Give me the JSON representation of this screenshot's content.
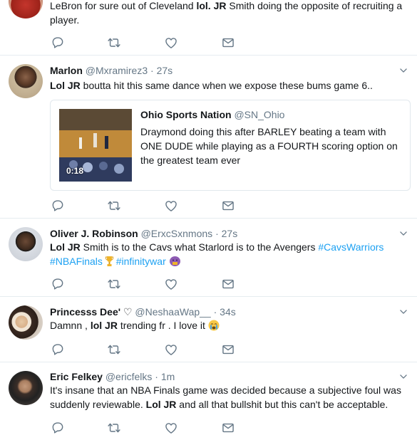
{
  "tweets": [
    {
      "text_parts": [
        "LeBron for sure out of Cleveland ",
        "lol.",
        "  ",
        "JR",
        " Smith doing the opposite of recruiting a player."
      ]
    },
    {
      "name": "Marlon",
      "handle": "@Mxramirez3",
      "time": "27s",
      "text_parts": [
        "Lol JR",
        " boutta hit this same dance when we expose these bums game 6.."
      ],
      "quoted": {
        "name": "Ohio Sports Nation",
        "handle": "@SN_Ohio",
        "text": "Draymond doing this after BARLEY beating a team with ONE DUDE while playing as a FOURTH scoring option on the greatest team ever",
        "duration": "0:18"
      }
    },
    {
      "name": "Oliver J. Robinson",
      "handle": "@ErxcSxnmons",
      "time": "27s",
      "text_parts": [
        "Lol JR",
        " Smith is to the Cavs what Starlord is to the Avengers "
      ],
      "hashtags": [
        "#CavsWarriors",
        "#NBAFinals",
        "#infinitywar"
      ]
    },
    {
      "name": "Princesss Dee'",
      "name_suffix": "♡",
      "handle": "@NeshaaWap__",
      "time": "34s",
      "text_parts": [
        "Damnn , ",
        "lol JR",
        " trending fr . I love it "
      ]
    },
    {
      "name": "Eric Felkey",
      "handle": "@ericfelks",
      "time": "1m",
      "text_parts": [
        "It's insane that an NBA Finals game was decided because a subjective foul was suddenly reviewable. ",
        "Lol JR",
        " and all that bullshit but this can't be acceptable."
      ]
    }
  ],
  "separator": "·",
  "colors": {
    "text": "#14171a",
    "secondary": "#657786",
    "link": "#1da1f2",
    "border": "#e6ecf0"
  },
  "icons": [
    "reply-icon",
    "retweet-icon",
    "like-icon",
    "message-icon",
    "chevron-down-icon"
  ]
}
